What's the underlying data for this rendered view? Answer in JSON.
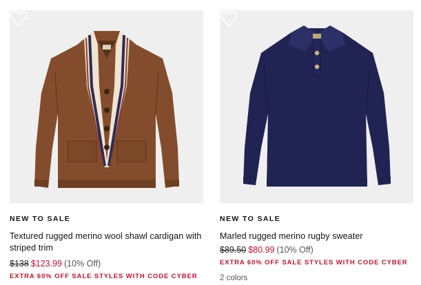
{
  "products": [
    {
      "badge": "NEW TO SALE",
      "title": "Textured rugged merino wool shawl cardigan with striped trim",
      "original_price": "$138",
      "sale_price": "$123.99",
      "discount": "(10% Off)",
      "promo": "EXTRA 60% OFF SALE STYLES WITH CODE CYBER",
      "image_subject": "brown shawl-collar cardigan",
      "icon": "heart-icon"
    },
    {
      "badge": "NEW TO SALE",
      "title": "Marled rugged merino rugby sweater",
      "original_price": "$89.50",
      "sale_price": "$80.99",
      "discount": "(10% Off)",
      "promo": "EXTRA 60% OFF SALE STYLES WITH CODE CYBER",
      "colors": "2 colors",
      "image_subject": "navy rugby sweater",
      "icon": "heart-icon"
    }
  ],
  "colors": {
    "sale_red": "#c8102e",
    "image_bg": "#efefef",
    "cardigan_brown": "#8a5230",
    "sweater_navy": "#26295a"
  }
}
